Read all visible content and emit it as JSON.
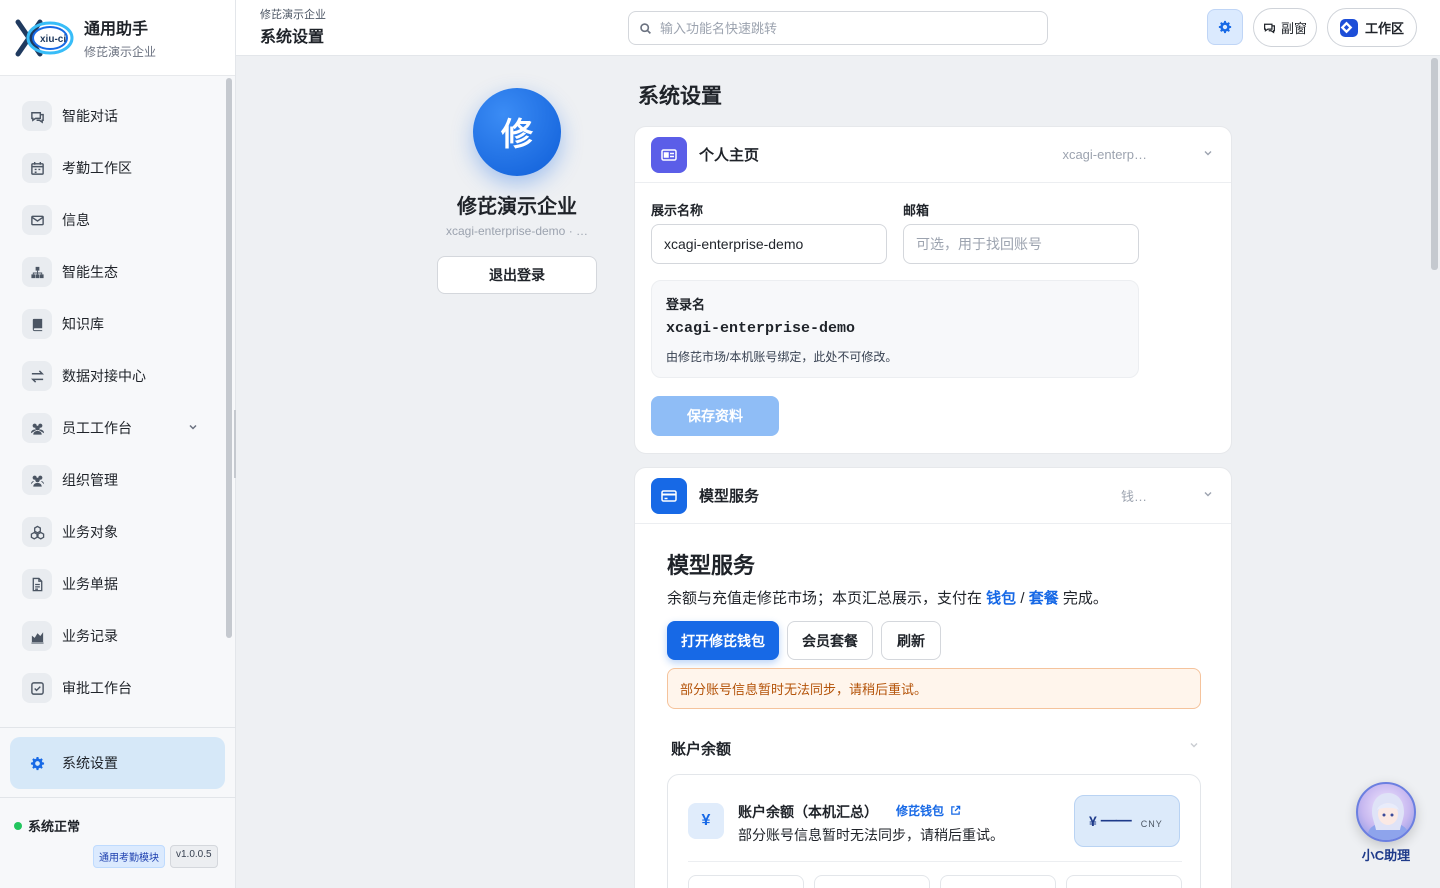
{
  "brand": {
    "title": "通用助手",
    "subtitle": "修芘演示企业",
    "logo_text": "xiu-ci"
  },
  "sidebar": {
    "items": [
      {
        "label": "智能对话",
        "icon": "chat-icon"
      },
      {
        "label": "考勤工作区",
        "icon": "calendar-icon"
      },
      {
        "label": "信息",
        "icon": "mail-icon"
      },
      {
        "label": "智能生态",
        "icon": "sitemap-icon"
      },
      {
        "label": "知识库",
        "icon": "book-icon"
      },
      {
        "label": "数据对接中心",
        "icon": "exchange-icon"
      },
      {
        "label": "员工工作台",
        "icon": "users-icon",
        "has_submenu": true
      },
      {
        "label": "组织管理",
        "icon": "users-icon"
      },
      {
        "label": "业务对象",
        "icon": "cubes-icon"
      },
      {
        "label": "业务单据",
        "icon": "document-icon"
      },
      {
        "label": "业务记录",
        "icon": "bar-chart-icon"
      },
      {
        "label": "审批工作台",
        "icon": "check-square-icon"
      }
    ],
    "active_item": {
      "label": "系统设置",
      "icon": "gear-icon"
    },
    "status": "系统正常",
    "module_badge": "通用考勤模块",
    "version": "v1.0.0.5"
  },
  "header": {
    "breadcrumb": "修芘演示企业",
    "title": "系统设置",
    "search_placeholder": "输入功能名快速跳转",
    "float_window": "副窗",
    "workspace": "工作区"
  },
  "profile": {
    "avatar_char": "修",
    "org_name": "修芘演示企业",
    "org_account": "xcagi-enterprise-demo · …",
    "logout": "退出登录"
  },
  "settings": {
    "page_title": "系统设置",
    "personal": {
      "title": "个人主页",
      "meta": "xcagi-enterp…",
      "display_name_label": "展示名称",
      "display_name_value": "xcagi-enterprise-demo",
      "email_label": "邮箱",
      "email_placeholder": "可选，用于找回账号",
      "login_label": "登录名",
      "login_value": "xcagi-enterprise-demo",
      "login_note": "由修芘市场/本机账号绑定，此处不可修改。",
      "save": "保存资料"
    },
    "model": {
      "title": "模型服务",
      "meta": "钱…",
      "heading": "模型服务",
      "desc_before": "余额与充值走修芘市场；本页汇总展示，支付在 ",
      "desc_link1": "钱包",
      "desc_sep": " / ",
      "desc_link2": "套餐",
      "desc_after": " 完成。",
      "btn_wallet": "打开修芘钱包",
      "btn_plan": "会员套餐",
      "btn_refresh": "刷新",
      "alert": "部分账号信息暂时无法同步，请稍后重试。",
      "balance_section": "账户余额",
      "balance_title": "账户余额（本机汇总）",
      "wallet_link": "修芘钱包",
      "balance_note": "部分账号信息暂时无法同步，请稍后重试。",
      "currency_symbol": "¥",
      "amount": "——",
      "currency": "CNY"
    }
  },
  "assistant": {
    "label": "小C助理"
  },
  "colors": {
    "accent": "#1769e6",
    "sidebar_active": "#d6e8f8",
    "status_ok": "#22c55e",
    "alert_text": "#b45309"
  }
}
